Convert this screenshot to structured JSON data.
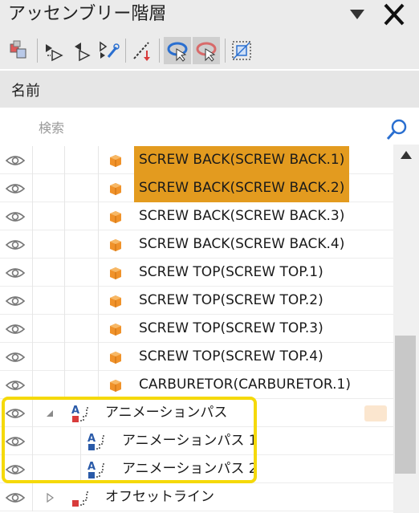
{
  "panel": {
    "title": "アッセンブリー階層"
  },
  "header": {
    "column_label": "名前"
  },
  "search": {
    "placeholder": "検索",
    "value": ""
  },
  "colors": {
    "selection": "#e39b1f",
    "part_icon": "#f0922a",
    "highlight_border": "#f5d90a",
    "marker": "#fbe6cf"
  },
  "toolbar": {
    "buttons": [
      {
        "icon": "assembly-icon"
      },
      {
        "icon": "step-forward-icon"
      },
      {
        "icon": "step-back-forward-icon"
      },
      {
        "icon": "edit-steps-icon"
      },
      {
        "icon": "path-line-icon"
      },
      {
        "icon": "rotate-view-icon",
        "active": true
      },
      {
        "icon": "rotate-reset-icon",
        "active": true
      },
      {
        "icon": "fit-frame-icon"
      }
    ]
  },
  "tree": {
    "items": [
      {
        "label": "SCREW BACK(SCREW BACK.1)",
        "selected": true,
        "type": "part"
      },
      {
        "label": "SCREW BACK(SCREW BACK.2)",
        "selected": true,
        "type": "part"
      },
      {
        "label": "SCREW BACK(SCREW BACK.3)",
        "selected": false,
        "type": "part"
      },
      {
        "label": "SCREW BACK(SCREW BACK.4)",
        "selected": false,
        "type": "part"
      },
      {
        "label": "SCREW TOP(SCREW TOP.1)",
        "selected": false,
        "type": "part"
      },
      {
        "label": "SCREW TOP(SCREW TOP.2)",
        "selected": false,
        "type": "part"
      },
      {
        "label": "SCREW TOP(SCREW TOP.3)",
        "selected": false,
        "type": "part"
      },
      {
        "label": "SCREW TOP(SCREW TOP.4)",
        "selected": false,
        "type": "part"
      },
      {
        "label": "CARBURETOR(CARBURETOR.1)",
        "selected": false,
        "type": "part"
      },
      {
        "label": "アニメーションパス",
        "selected": false,
        "type": "animation-group",
        "expanded": true
      },
      {
        "label": "アニメーションパス 1",
        "selected": false,
        "type": "animation-path"
      },
      {
        "label": "アニメーションパス 2",
        "selected": false,
        "type": "animation-path"
      },
      {
        "label": "オフセットライン",
        "selected": false,
        "type": "offset-group",
        "expanded": false
      }
    ]
  }
}
